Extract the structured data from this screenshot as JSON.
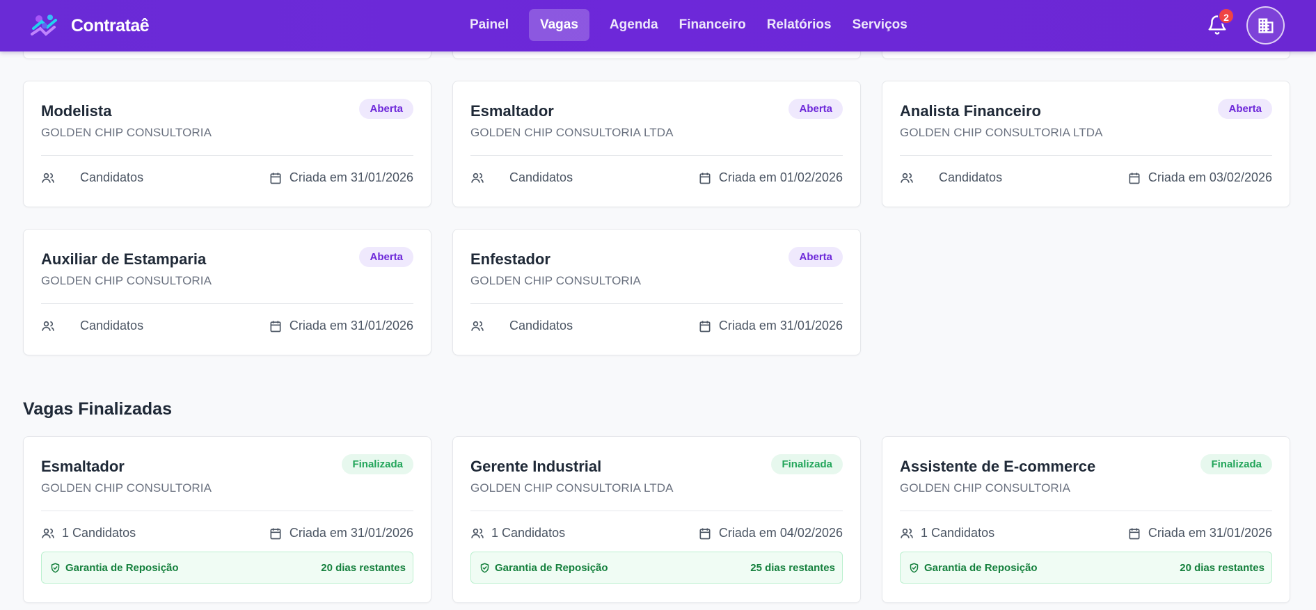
{
  "header": {
    "brand": "Contrataê",
    "nav": [
      "Painel",
      "Vagas",
      "Agenda",
      "Financeiro",
      "Relatórios",
      "Serviços"
    ],
    "active_nav": "Vagas",
    "notifications_count": "2"
  },
  "open_jobs": [
    {
      "title": "Modelista",
      "company": "GOLDEN CHIP CONSULTORIA",
      "status": "Aberta",
      "candidates": "Candidatos",
      "created": "Criada em 31/01/2026"
    },
    {
      "title": "Esmaltador",
      "company": "GOLDEN CHIP CONSULTORIA LTDA",
      "status": "Aberta",
      "candidates": "Candidatos",
      "created": "Criada em 01/02/2026"
    },
    {
      "title": "Analista Financeiro",
      "company": "GOLDEN CHIP CONSULTORIA LTDA",
      "status": "Aberta",
      "candidates": "Candidatos",
      "created": "Criada em 03/02/2026"
    },
    {
      "title": "Auxiliar de Estamparia",
      "company": "GOLDEN CHIP CONSULTORIA",
      "status": "Aberta",
      "candidates": "Candidatos",
      "created": "Criada em 31/01/2026"
    },
    {
      "title": "Enfestador",
      "company": "GOLDEN CHIP CONSULTORIA",
      "status": "Aberta",
      "candidates": "Candidatos",
      "created": "Criada em 31/01/2026"
    }
  ],
  "finished_section_title": "Vagas Finalizadas",
  "finished_jobs": [
    {
      "title": "Esmaltador",
      "company": "GOLDEN CHIP CONSULTORIA",
      "status": "Finalizada",
      "candidates": "1 Candidatos",
      "created": "Criada em 31/01/2026",
      "guarantee": "Garantia de Reposição",
      "remaining": "20 dias restantes"
    },
    {
      "title": "Gerente Industrial",
      "company": "GOLDEN CHIP CONSULTORIA LTDA",
      "status": "Finalizada",
      "candidates": "1 Candidatos",
      "created": "Criada em 04/02/2026",
      "guarantee": "Garantia de Reposição",
      "remaining": "25 dias restantes"
    },
    {
      "title": "Assistente de E-commerce",
      "company": "GOLDEN CHIP CONSULTORIA",
      "status": "Finalizada",
      "candidates": "1 Candidatos",
      "created": "Criada em 31/01/2026",
      "guarantee": "Garantia de Reposição",
      "remaining": "20 dias restantes"
    }
  ],
  "colors": {
    "header": "#6d28d9",
    "open_badge_bg": "#efe9fd",
    "open_badge_text": "#6d28d9",
    "closed_badge_bg": "#e7f8ee",
    "closed_badge_text": "#22a55a",
    "guarantee_text": "#15803d",
    "notification_badge": "#ef4444"
  }
}
